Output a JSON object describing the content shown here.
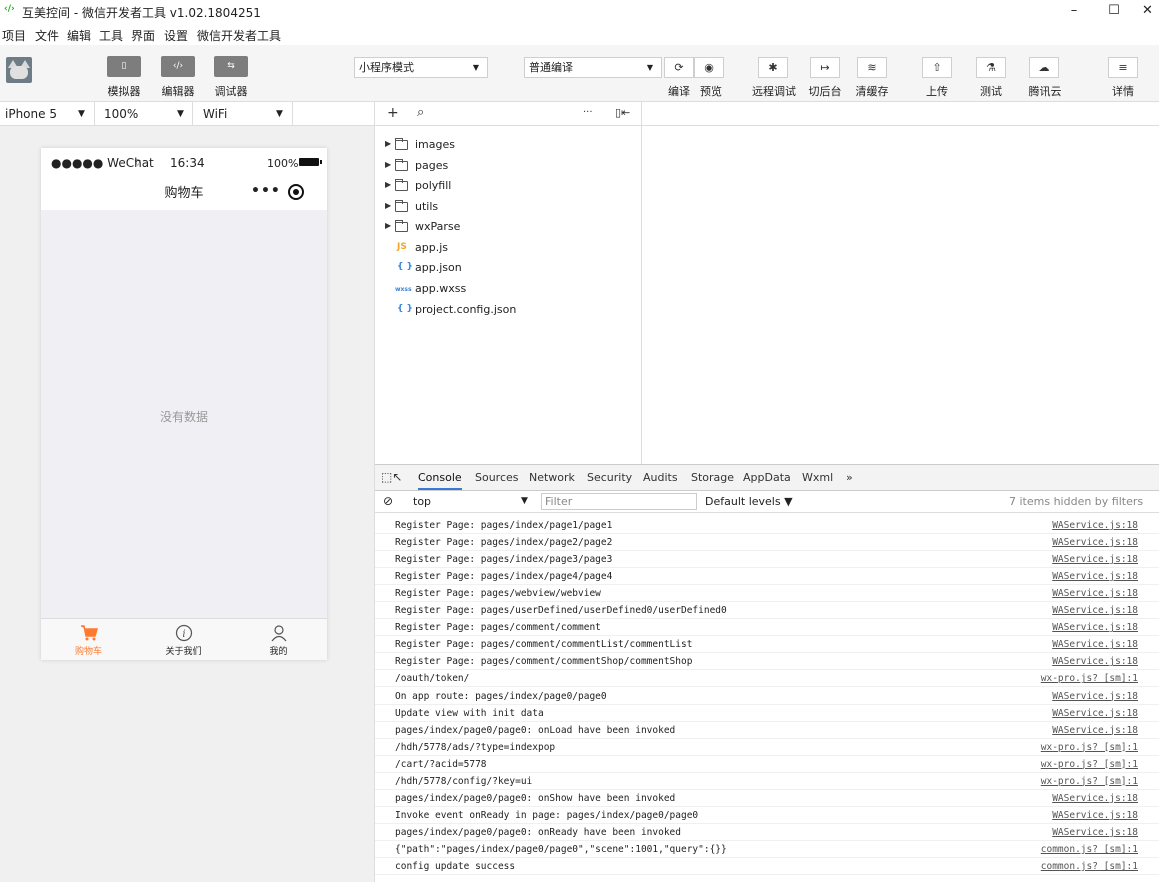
{
  "window": {
    "title": "互美控间 - 微信开发者工具 v1.02.1804251",
    "minimize": "–",
    "maximize": "☐",
    "close": "✕"
  },
  "menu": [
    "项目",
    "文件",
    "编辑",
    "工具",
    "界面",
    "设置",
    "微信开发者工具"
  ],
  "toolbar": {
    "simulator": "模拟器",
    "editor": "编辑器",
    "debugger": "调试器",
    "mode": "小程序模式",
    "compile_mode": "普通编译",
    "compile": "编译",
    "preview": "预览",
    "remote_debug": "远程调试",
    "background": "切后台",
    "clear_cache": "清缓存",
    "upload": "上传",
    "test": "测试",
    "tencent_cloud": "腾讯云",
    "details": "详情"
  },
  "device": {
    "model": "iPhone 5",
    "zoom": "100%",
    "network": "WiFi"
  },
  "phone": {
    "carrier": "●●●●● WeChat",
    "time": "16:34",
    "battery": "100%",
    "nav_title": "购物车",
    "empty_text": "没有数据",
    "tabs": [
      "购物车",
      "关于我们",
      "我的"
    ],
    "active_color": "#ff7a2f"
  },
  "files": [
    {
      "name": "images",
      "type": "folder"
    },
    {
      "name": "pages",
      "type": "folder"
    },
    {
      "name": "polyfill",
      "type": "folder"
    },
    {
      "name": "utils",
      "type": "folder"
    },
    {
      "name": "wxParse",
      "type": "folder"
    },
    {
      "name": "app.js",
      "type": "js",
      "badge": "JS"
    },
    {
      "name": "app.json",
      "type": "json",
      "badge": "{ }"
    },
    {
      "name": "app.wxss",
      "type": "wxss",
      "badge": "wxss"
    },
    {
      "name": "project.config.json",
      "type": "json",
      "badge": "{ }"
    }
  ],
  "devtools": {
    "tabs": [
      "Console",
      "Sources",
      "Network",
      "Security",
      "Audits",
      "Storage",
      "AppData",
      "Wxml",
      "»"
    ],
    "context": "top",
    "filter_placeholder": "Filter",
    "levels": "Default levels ▼",
    "hidden": "7 items hidden by filters"
  },
  "logs": [
    {
      "msg": "Register Page: pages/index/page1/page1",
      "src": "WAService.js:18"
    },
    {
      "msg": "Register Page: pages/index/page2/page2",
      "src": "WAService.js:18"
    },
    {
      "msg": "Register Page: pages/index/page3/page3",
      "src": "WAService.js:18"
    },
    {
      "msg": "Register Page: pages/index/page4/page4",
      "src": "WAService.js:18"
    },
    {
      "msg": "Register Page: pages/webview/webview",
      "src": "WAService.js:18"
    },
    {
      "msg": "Register Page: pages/userDefined/userDefined0/userDefined0",
      "src": "WAService.js:18"
    },
    {
      "msg": "Register Page: pages/comment/comment",
      "src": "WAService.js:18"
    },
    {
      "msg": "Register Page: pages/comment/commentList/commentList",
      "src": "WAService.js:18"
    },
    {
      "msg": "Register Page: pages/comment/commentShop/commentShop",
      "src": "WAService.js:18"
    },
    {
      "msg": "/oauth/token/",
      "src": "wx-pro.js? [sm]:1"
    },
    {
      "msg": "On app route: pages/index/page0/page0",
      "src": "WAService.js:18"
    },
    {
      "msg": "Update view with init data",
      "src": "WAService.js:18"
    },
    {
      "msg": "pages/index/page0/page0: onLoad have been invoked",
      "src": "WAService.js:18"
    },
    {
      "msg": "/hdh/5778/ads/?type=indexpop",
      "src": "wx-pro.js? [sm]:1"
    },
    {
      "msg": "/cart/?acid=5778",
      "src": "wx-pro.js? [sm]:1"
    },
    {
      "msg": "/hdh/5778/config/?key=ui",
      "src": "wx-pro.js? [sm]:1"
    },
    {
      "msg": "pages/index/page0/page0: onShow have been invoked",
      "src": "WAService.js:18"
    },
    {
      "msg": "Invoke event onReady in page: pages/index/page0/page0",
      "src": "WAService.js:18"
    },
    {
      "msg": "pages/index/page0/page0: onReady have been invoked",
      "src": "WAService.js:18"
    },
    {
      "msg": "{\"path\":\"pages/index/page0/page0\",\"scene\":1001,\"query\":{}}",
      "src": "common.js? [sm]:1"
    },
    {
      "msg": "config update success",
      "src": "common.js? [sm]:1"
    }
  ]
}
